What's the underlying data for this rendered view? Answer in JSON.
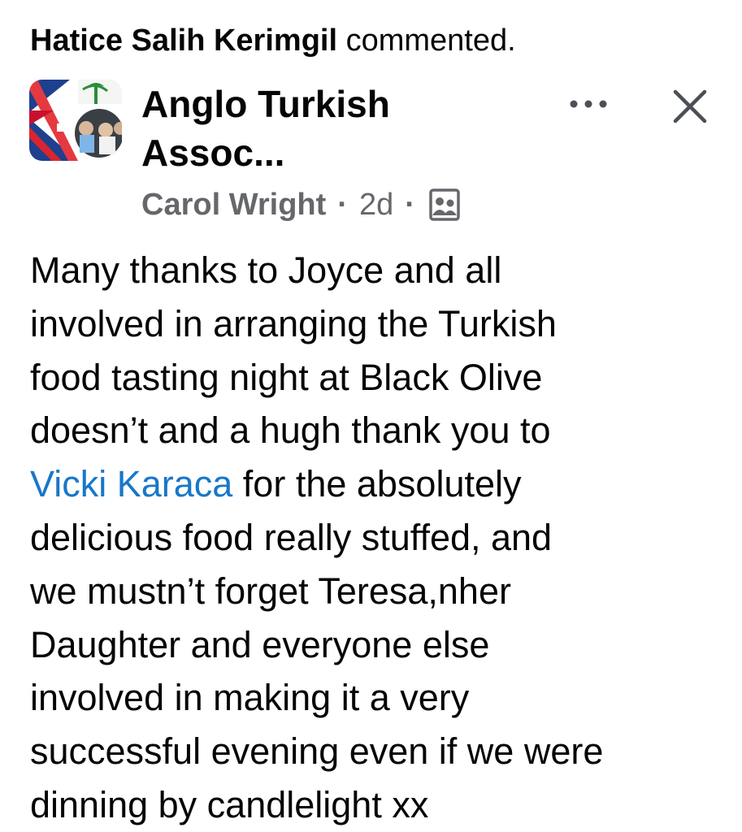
{
  "activity": {
    "actor": "Hatice Salih Kerimgil",
    "action": "commented."
  },
  "post": {
    "group_name_line1": "Anglo Turkish",
    "group_name_line2": "Assoc...",
    "author": "Carol Wright",
    "separator": "·",
    "time": "2d",
    "privacy_icon": "members-group-icon",
    "body_lines": [
      "Many thanks to Joyce and all",
      "involved in arranging the Turkish",
      "food tasting night at Black Olive",
      "doesn’t and a hugh thank you to",
      "for the absolutely",
      "delicious food really stuffed, and",
      "we mustn’t forget Teresa,nher",
      "Daughter and everyone else",
      "involved in making it a very",
      "successful evening even if we were",
      "dinning by candlelight xx"
    ],
    "mention": "Vicki Karaca"
  },
  "icons": {
    "more": "more-horizontal-icon",
    "close": "close-icon"
  },
  "colors": {
    "mention": "#1877c9",
    "meta_text": "#65676b",
    "text": "#050505"
  }
}
